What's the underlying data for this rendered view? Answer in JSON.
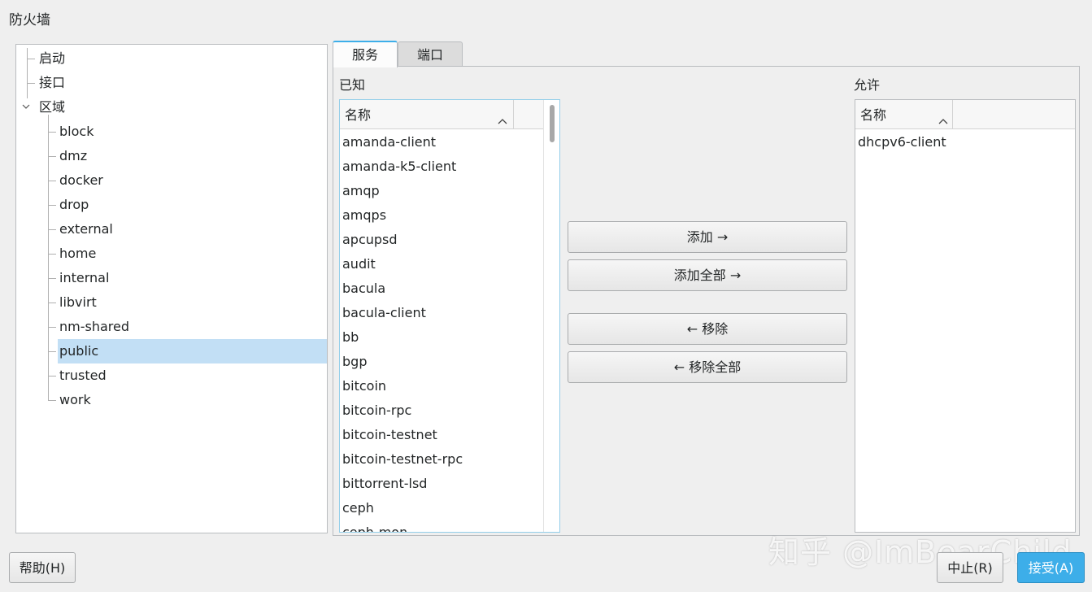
{
  "window": {
    "title": "防火墙"
  },
  "tree": {
    "items": [
      {
        "label": "启动",
        "level": 0
      },
      {
        "label": "接口",
        "level": 0
      },
      {
        "label": "区域",
        "level": 0,
        "expanded": true
      },
      {
        "label": "block",
        "level": 1
      },
      {
        "label": "dmz",
        "level": 1
      },
      {
        "label": "docker",
        "level": 1
      },
      {
        "label": "drop",
        "level": 1
      },
      {
        "label": "external",
        "level": 1
      },
      {
        "label": "home",
        "level": 1
      },
      {
        "label": "internal",
        "level": 1
      },
      {
        "label": "libvirt",
        "level": 1
      },
      {
        "label": "nm-shared",
        "level": 1
      },
      {
        "label": "public",
        "level": 1,
        "selected": true
      },
      {
        "label": "trusted",
        "level": 1
      },
      {
        "label": "work",
        "level": 1
      }
    ],
    "expander_icon": "chevron-down-icon"
  },
  "tabs": [
    {
      "label": "服务",
      "active": true
    },
    {
      "label": "端口",
      "active": false
    }
  ],
  "known": {
    "label": "已知",
    "column_header": "名称",
    "items": [
      "amanda-client",
      "amanda-k5-client",
      "amqp",
      "amqps",
      "apcupsd",
      "audit",
      "bacula",
      "bacula-client",
      "bb",
      "bgp",
      "bitcoin",
      "bitcoin-rpc",
      "bitcoin-testnet",
      "bitcoin-testnet-rpc",
      "bittorrent-lsd",
      "ceph",
      "ceph-mon"
    ]
  },
  "allowed": {
    "label": "允许",
    "column_header": "名称",
    "items": [
      "dhcpv6-client"
    ]
  },
  "actions": {
    "add": "添加 →",
    "add_all": "添加全部 →",
    "remove": "← 移除",
    "remove_all": "← 移除全部"
  },
  "footer": {
    "help": "帮助(H)",
    "cancel": "中止(R)",
    "accept": "接受(A)"
  },
  "watermark": "知乎 @ImBearChild",
  "colors": {
    "accent": "#3daee9",
    "selection": "#c2dff5"
  }
}
